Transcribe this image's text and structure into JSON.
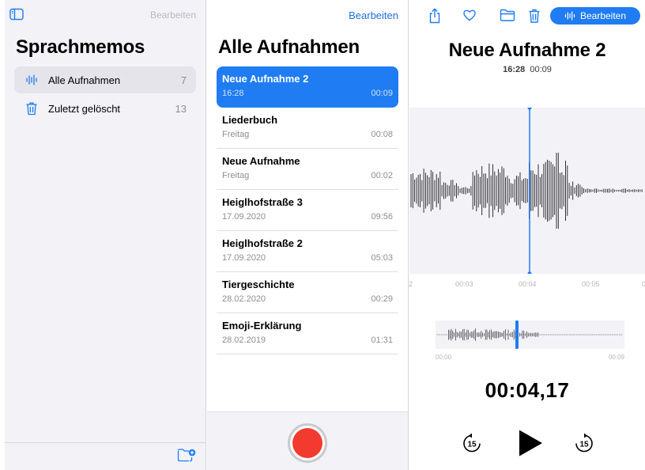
{
  "sidebar": {
    "edit_label": "Bearbeiten",
    "title": "Sprachmemos",
    "items": [
      {
        "label": "Alle Aufnahmen",
        "count": "7",
        "icon": "waveform-icon"
      },
      {
        "label": "Zuletzt gelöscht",
        "count": "13",
        "icon": "trash-icon"
      }
    ]
  },
  "list": {
    "edit_label": "Bearbeiten",
    "title": "Alle Aufnahmen",
    "recordings": [
      {
        "name": "Neue Aufnahme 2",
        "date": "16:28",
        "duration": "00:09"
      },
      {
        "name": "Liederbuch",
        "date": "Freitag",
        "duration": "00:08"
      },
      {
        "name": "Neue Aufnahme",
        "date": "Freitag",
        "duration": "00:02"
      },
      {
        "name": "Heiglhofstraße 3",
        "date": "17.09.2020",
        "duration": "09:56"
      },
      {
        "name": "Heiglhofstraße 2",
        "date": "17.09.2020",
        "duration": "05:03"
      },
      {
        "name": "Tiergeschichte",
        "date": "28.02.2020",
        "duration": "00:29"
      },
      {
        "name": "Emoji-Erklärung",
        "date": "28.02.2019",
        "duration": "01:31"
      }
    ]
  },
  "detail": {
    "toolbar": {
      "edit_label": "Bearbeiten"
    },
    "title": "Neue Aufnahme 2",
    "time": "16:28",
    "duration": "00:09",
    "axis_labels": [
      "2",
      "00:03",
      "00:04",
      "00:05",
      "0"
    ],
    "overview_start": "00:00",
    "overview_end": "00:09",
    "current_time": "00:04,17",
    "skip_back_label": "15",
    "skip_forward_label": "15"
  },
  "colors": {
    "accent": "#1f7cf2",
    "record": "#f23a2f",
    "sidebar_bg": "#f2f2f7"
  }
}
